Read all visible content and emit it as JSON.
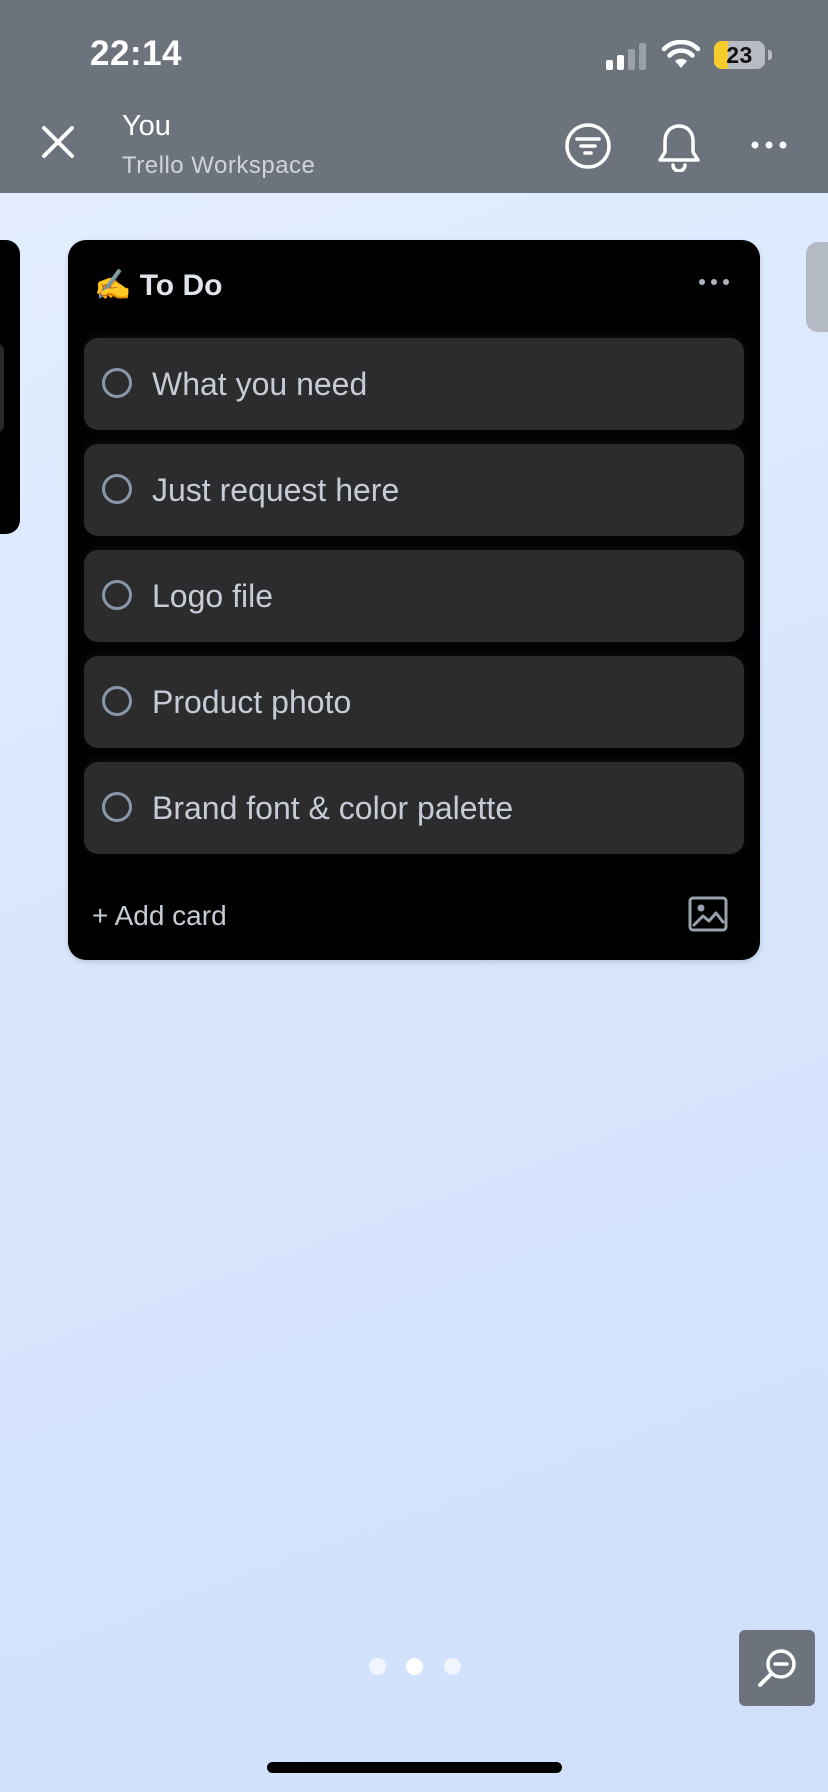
{
  "status_bar": {
    "time": "22:14",
    "battery_level": "23",
    "signal_bars_active": 2,
    "signal_bars_total": 4
  },
  "header": {
    "title": "You",
    "subtitle": "Trello Workspace",
    "icons": [
      "close-icon",
      "filter-icon",
      "bell-icon",
      "more-icon"
    ]
  },
  "list": {
    "emoji": "✍️",
    "title": "To Do",
    "cards": [
      {
        "label": "What you need"
      },
      {
        "label": "Just request here"
      },
      {
        "label": "Logo file"
      },
      {
        "label": "Product photo"
      },
      {
        "label": "Brand font & color palette"
      }
    ],
    "add_card_label": "+ Add card"
  },
  "pagination": {
    "count": 3,
    "active_index": 1
  },
  "colors": {
    "header_bg": "#6d737c",
    "list_bg": "#000000",
    "card_bg": "#2c2c2e",
    "card_text": "#c5ccd6",
    "battery_low": "#f5cc2a"
  }
}
